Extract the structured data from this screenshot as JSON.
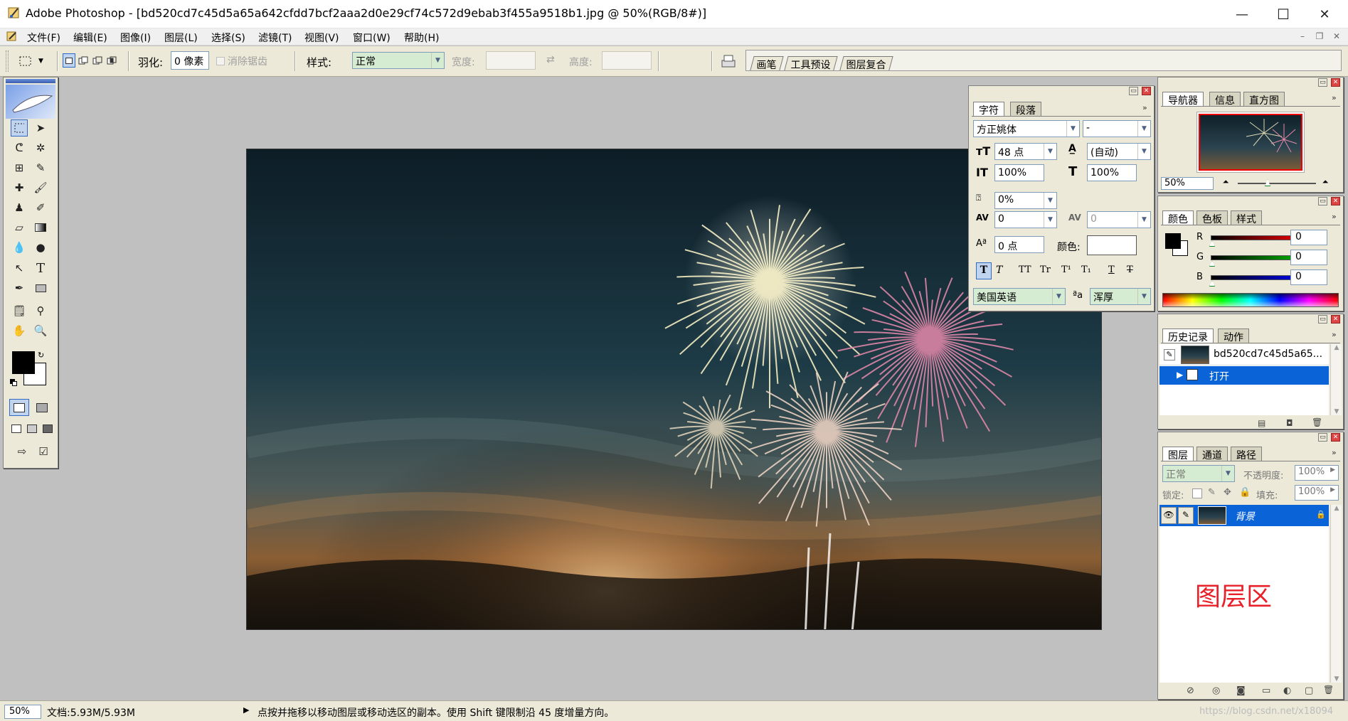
{
  "window": {
    "title": "Adobe Photoshop - [bd520cd7c45d5a65a642cfdd7bcf2aaa2d0e29cf74c572d9ebab3f455a9518b1.jpg @ 50%(RGB/8#)]",
    "controls": [
      "—",
      "☐",
      "✕"
    ]
  },
  "menu": [
    "文件(F)",
    "编辑(E)",
    "图像(I)",
    "图层(L)",
    "选择(S)",
    "滤镜(T)",
    "视图(V)",
    "窗口(W)",
    "帮助(H)"
  ],
  "options": {
    "feather_label": "羽化:",
    "feather_value": "0 像素",
    "antialias_label": "消除锯齿",
    "style_label": "样式:",
    "style_value": "正常",
    "width_label": "宽度:",
    "height_label": "高度:",
    "palette_tabs": [
      "画笔",
      "工具预设",
      "图层复合"
    ]
  },
  "character_panel": {
    "tabs": [
      "字符",
      "段落"
    ],
    "font_family": "方正姚体",
    "font_style": "-",
    "font_size": "48 点",
    "leading": "(自动)",
    "vertical_scale": "100%",
    "horizontal_scale": "100%",
    "tsume": "0%",
    "kerning": "0",
    "tracking": "0",
    "baseline_shift": "0 点",
    "color_label": "颜色:",
    "style_buttons": [
      "T",
      "T",
      "TT",
      "Tr",
      "T¹",
      "T₁",
      "T",
      "T"
    ],
    "language": "美国英语",
    "antialias_icon": "ªa",
    "antialias": "浑厚"
  },
  "navigator_panel": {
    "tabs": [
      "导航器",
      "信息",
      "直方图"
    ],
    "zoom": "50%"
  },
  "color_panel": {
    "tabs": [
      "颜色",
      "色板",
      "样式"
    ],
    "channels": [
      {
        "label": "R",
        "value": "0",
        "color": "#ff0000"
      },
      {
        "label": "G",
        "value": "0",
        "color": "#00c000"
      },
      {
        "label": "B",
        "value": "0",
        "color": "#0000ff"
      }
    ]
  },
  "history_panel": {
    "tabs": [
      "历史记录",
      "动作"
    ],
    "snapshot": "bd520cd7c45d5a65...",
    "items": [
      "打开"
    ]
  },
  "layers_panel": {
    "tabs": [
      "图层",
      "通道",
      "路径"
    ],
    "blend_mode": "正常",
    "opacity_label": "不透明度:",
    "opacity_value": "100%",
    "lock_label": "锁定:",
    "fill_label": "填充:",
    "fill_value": "100%",
    "layers": [
      {
        "name": "背景",
        "selected": true
      }
    ],
    "annotation": "图层区",
    "annotation_color": "#e8202a"
  },
  "status": {
    "zoom": "50%",
    "doc": "文档:5.93M/5.93M",
    "hint": "点按并拖移以移动图层或移动选区的副本。使用 Shift 键限制沿 45 度增量方向。",
    "watermark": "https://blog.csdn.net/x18094"
  },
  "colors": {
    "selection_blue": "#0a64d8",
    "panel_bg": "#ece9d8",
    "workspace": "#c0c0c0"
  }
}
